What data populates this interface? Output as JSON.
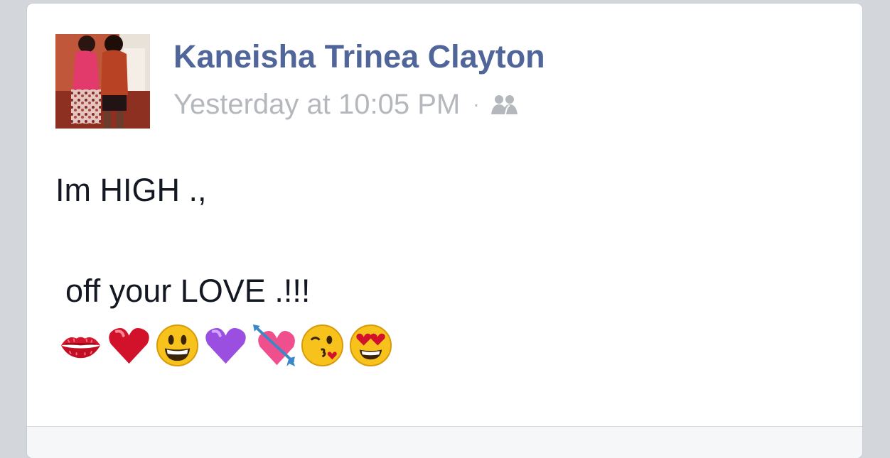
{
  "post": {
    "author": "Kaneisha Trinea Clayton",
    "timestamp": "Yesterday at 10:05 PM",
    "separator": "·",
    "audience_icon": "friends-icon",
    "text_line1": "Im HIGH .,",
    "text_line2": "off your LOVE .!!!",
    "emojis": [
      "kiss-mark-emoji",
      "red-heart-emoji",
      "grinning-face-emoji",
      "purple-heart-emoji",
      "heart-with-arrow-emoji",
      "face-blowing-kiss-emoji",
      "heart-eyes-emoji"
    ]
  },
  "colors": {
    "author_link": "#50669a",
    "meta_text": "#b4b7bc",
    "body_text": "#141823",
    "page_background": "#d3d6db",
    "card_background": "#ffffff"
  }
}
